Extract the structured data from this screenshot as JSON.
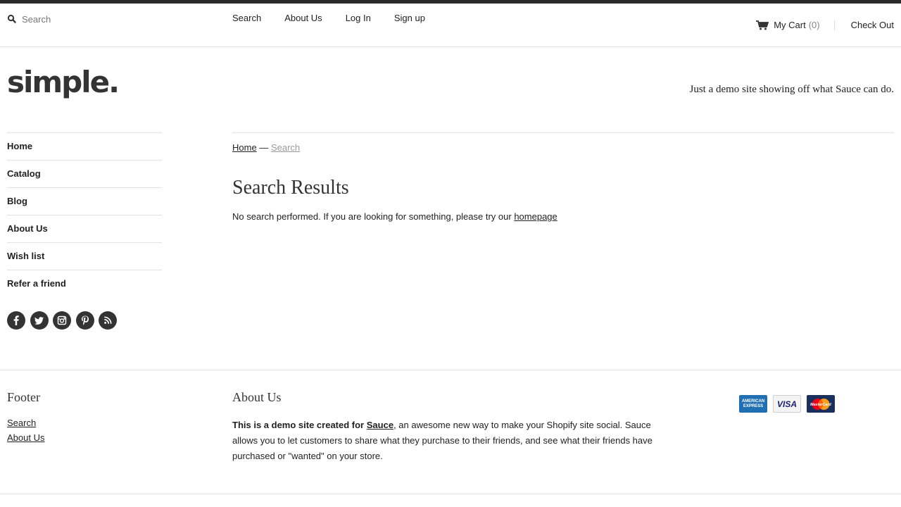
{
  "header": {
    "search_placeholder": "Search",
    "links": [
      "Search",
      "About Us",
      "Log In",
      "Sign up"
    ],
    "cart_label": "My Cart",
    "cart_count": "(0)",
    "checkout_label": "Check Out"
  },
  "brand": {
    "logo": "simple.",
    "tagline": "Just a demo site showing off what Sauce can do."
  },
  "sidebar": {
    "items": [
      "Home",
      "Catalog",
      "Blog",
      "About Us",
      "Wish list",
      "Refer a friend"
    ],
    "socials": [
      "facebook-icon",
      "twitter-icon",
      "instagram-icon",
      "pinterest-icon",
      "rss-icon"
    ]
  },
  "breadcrumb": {
    "home": "Home",
    "separator": "—",
    "current": "Search"
  },
  "main": {
    "title": "Search Results",
    "message": "No search performed. If you are looking for something, please try our",
    "homepage_link": "homepage"
  },
  "footer": {
    "col1_title": "Footer",
    "col1_links": [
      "Search",
      "About Us"
    ],
    "col2_title": "About Us",
    "about_bold": "This is a demo site created for",
    "about_link": "Sauce",
    "about_rest": ", an awesome new way to make your Shopify site social. Sauce allows you to let customers to share what they purchase to their friends, and see what their friends have purchased or \"wanted\" on your store.",
    "payments": {
      "amex": "AMERICAN EXPRESS",
      "visa": "VISA",
      "mastercard": "MasterCard"
    }
  },
  "colors": {
    "top_strip": "#2b2b2b",
    "text": "#222222",
    "muted": "#999999",
    "rule": "#e2e2e2"
  }
}
